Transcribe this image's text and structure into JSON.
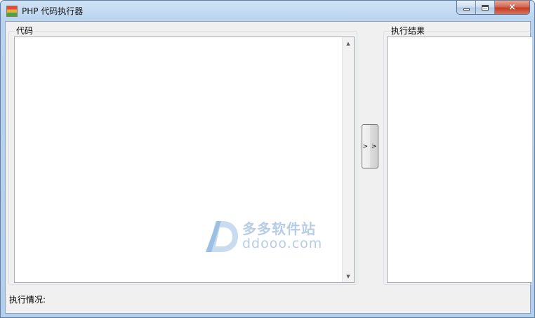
{
  "window": {
    "title": "PHP 代码执行器",
    "controls": {
      "minimize": "minimize-icon",
      "maximize": "maximize-icon",
      "close": "×"
    }
  },
  "code_panel": {
    "label": "代码",
    "value": ""
  },
  "run_button": {
    "label": "> >"
  },
  "result_panel": {
    "label": "执行结果",
    "value": ""
  },
  "status": {
    "label": "执行情况:"
  },
  "watermark": {
    "name": "多多软件站",
    "domain": "ddooo.com"
  },
  "colors": {
    "titlebar": "#b9d3ee",
    "client_bg": "#f0f0f0",
    "close_button": "#c43b22",
    "watermark": "#b7cde6"
  }
}
